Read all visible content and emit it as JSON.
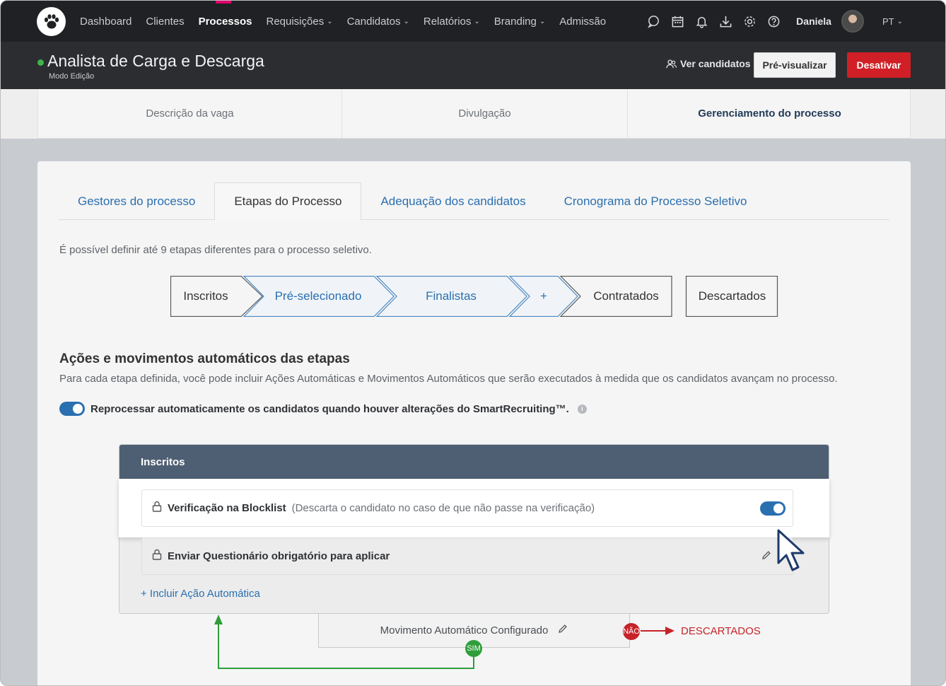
{
  "nav": {
    "items": [
      {
        "label": "Dashboard",
        "dropdown": false,
        "active": false
      },
      {
        "label": "Clientes",
        "dropdown": false,
        "active": false
      },
      {
        "label": "Processos",
        "dropdown": false,
        "active": true
      },
      {
        "label": "Requisições",
        "dropdown": true,
        "active": false
      },
      {
        "label": "Candidatos",
        "dropdown": true,
        "active": false
      },
      {
        "label": "Relatórios",
        "dropdown": true,
        "active": false
      },
      {
        "label": "Branding",
        "dropdown": true,
        "active": false
      },
      {
        "label": "Admissão",
        "dropdown": false,
        "active": false
      }
    ],
    "icons": [
      "chat-icon",
      "calendar-icon",
      "bell-icon",
      "download-icon",
      "gear-icon",
      "help-icon"
    ],
    "user_name": "Daniela",
    "language": "PT"
  },
  "job": {
    "title": "Analista de Carga e Descarga",
    "mode": "Modo Edição",
    "status_color": "#3fb54a",
    "view_candidates": "Ver candidatos",
    "preview": "Pré-visualizar",
    "deactivate": "Desativar"
  },
  "main_tabs": [
    {
      "label": "Descrição da vaga",
      "active": false
    },
    {
      "label": "Divulgação",
      "active": false
    },
    {
      "label": "Gerenciamento do processo",
      "active": true
    }
  ],
  "sub_tabs": [
    {
      "label": "Gestores do processo",
      "active": false
    },
    {
      "label": "Etapas do Processo",
      "active": true
    },
    {
      "label": "Adequação dos candidatos",
      "active": false
    },
    {
      "label": "Cronograma do Processo Seletivo",
      "active": false
    }
  ],
  "stages_info": "É possível definir até 9 etapas diferentes para o processo seletivo.",
  "stages": {
    "inscritos": "Inscritos",
    "pre_selecionado": "Pré-selecionado",
    "finalistas": "Finalistas",
    "add": "+",
    "contratados": "Contratados",
    "descartados": "Descartados"
  },
  "auto_actions": {
    "title": "Ações e movimentos automáticos das etapas",
    "description": "Para cada etapa definida, você pode incluir Ações Automáticas e Movimentos Automáticos que serão executados à medida que os candidatos avançam no processo.",
    "reprocess_label": "Reprocessar automaticamente os candidatos quando houver alterações do SmartRecruiting™.",
    "reprocess_on": true
  },
  "stage_box": {
    "title": "Inscritos",
    "actions": [
      {
        "label": "Verificação na Blocklist",
        "note": "(Descarta o candidato no caso de que não passe na verificação)",
        "toggle_on": true
      },
      {
        "label": "Enviar Questionário obrigatório para aplicar"
      }
    ],
    "include_link": "+ Incluir Ação Automática",
    "movement": "Movimento Automático Configurado",
    "no_label": "NÃO",
    "yes_label": "SIM",
    "descartados_label": "DESCARTADOS"
  },
  "colors": {
    "accent_blue": "#2a6fb0",
    "danger_red": "#d01f26",
    "success_green": "#2f9e3a",
    "header_slate": "#4f5f73"
  }
}
